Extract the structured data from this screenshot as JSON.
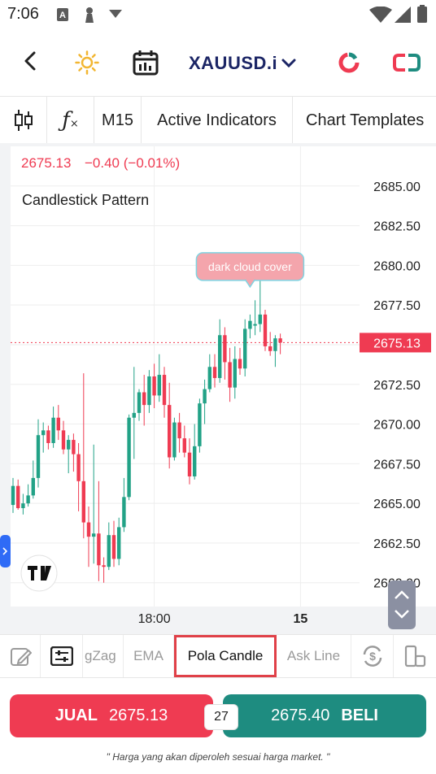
{
  "status": {
    "time": "7:06"
  },
  "header": {
    "symbol": "XAUUSD.i"
  },
  "toolbar": {
    "items": [
      {
        "label": "M15"
      },
      {
        "label": "Active Indicators"
      },
      {
        "label": "Chart Templates"
      }
    ]
  },
  "chart": {
    "price_label": "2675.13",
    "change_label": "−0.40 (−0.01%)",
    "title": "Candlestick Pattern",
    "annotation": "dark cloud cover",
    "current_price_tag": "2675.13",
    "logo": "TV"
  },
  "chart_data": {
    "type": "candlestick",
    "title": "Candlestick Pattern",
    "symbol": "XAUUSD.i",
    "timeframe": "M15",
    "ylim": [
      2658.5,
      2687.5
    ],
    "y_ticks": [
      "2685.00",
      "2682.50",
      "2680.00",
      "2677.50",
      "2675.00",
      "2672.50",
      "2670.00",
      "2667.50",
      "2665.00",
      "2662.50",
      "2660.00"
    ],
    "x_ticks": [
      "18:00",
      "15"
    ],
    "last_price": 2675.13,
    "annotation": {
      "text": "dark cloud cover",
      "candle_index": 47
    },
    "up_color": "#22a287",
    "down_color": "#ef3b52",
    "candles": [
      {
        "o": 2664.9,
        "h": 2666.6,
        "l": 2664.4,
        "c": 2666.1
      },
      {
        "o": 2666.1,
        "h": 2666.5,
        "l": 2664.6,
        "c": 2664.7
      },
      {
        "o": 2664.7,
        "h": 2665.6,
        "l": 2664.3,
        "c": 2665.0
      },
      {
        "o": 2665.0,
        "h": 2666.2,
        "l": 2664.8,
        "c": 2665.5
      },
      {
        "o": 2665.5,
        "h": 2667.7,
        "l": 2665.3,
        "c": 2666.6
      },
      {
        "o": 2666.6,
        "h": 2670.3,
        "l": 2666.0,
        "c": 2669.3
      },
      {
        "o": 2669.3,
        "h": 2670.1,
        "l": 2668.2,
        "c": 2669.6
      },
      {
        "o": 2669.6,
        "h": 2669.9,
        "l": 2668.4,
        "c": 2668.8
      },
      {
        "o": 2668.8,
        "h": 2671.1,
        "l": 2668.5,
        "c": 2670.4
      },
      {
        "o": 2670.4,
        "h": 2671.2,
        "l": 2669.0,
        "c": 2669.6
      },
      {
        "o": 2669.6,
        "h": 2670.2,
        "l": 2668.1,
        "c": 2668.4
      },
      {
        "o": 2668.4,
        "h": 2669.3,
        "l": 2666.9,
        "c": 2669.0
      },
      {
        "o": 2669.0,
        "h": 2669.4,
        "l": 2667.0,
        "c": 2668.1
      },
      {
        "o": 2668.1,
        "h": 2668.8,
        "l": 2664.5,
        "c": 2666.4
      },
      {
        "o": 2666.4,
        "h": 2673.2,
        "l": 2662.8,
        "c": 2663.8
      },
      {
        "o": 2663.8,
        "h": 2664.8,
        "l": 2661.0,
        "c": 2662.9
      },
      {
        "o": 2662.9,
        "h": 2668.7,
        "l": 2661.2,
        "c": 2663.1
      },
      {
        "o": 2663.1,
        "h": 2666.4,
        "l": 2660.1,
        "c": 2661.1
      },
      {
        "o": 2661.1,
        "h": 2661.6,
        "l": 2660.0,
        "c": 2661.0
      },
      {
        "o": 2661.0,
        "h": 2663.8,
        "l": 2660.8,
        "c": 2663.0
      },
      {
        "o": 2663.0,
        "h": 2663.9,
        "l": 2661.0,
        "c": 2661.5
      },
      {
        "o": 2661.5,
        "h": 2664.1,
        "l": 2661.1,
        "c": 2663.5
      },
      {
        "o": 2663.5,
        "h": 2666.6,
        "l": 2663.2,
        "c": 2665.4
      },
      {
        "o": 2665.4,
        "h": 2670.6,
        "l": 2665.2,
        "c": 2670.4
      },
      {
        "o": 2670.4,
        "h": 2673.6,
        "l": 2667.8,
        "c": 2670.7
      },
      {
        "o": 2670.7,
        "h": 2672.2,
        "l": 2670.2,
        "c": 2672.0
      },
      {
        "o": 2672.0,
        "h": 2673.1,
        "l": 2669.9,
        "c": 2671.2
      },
      {
        "o": 2671.2,
        "h": 2673.4,
        "l": 2670.7,
        "c": 2673.0
      },
      {
        "o": 2673.0,
        "h": 2673.8,
        "l": 2671.0,
        "c": 2671.8
      },
      {
        "o": 2671.8,
        "h": 2674.4,
        "l": 2671.4,
        "c": 2673.1
      },
      {
        "o": 2673.1,
        "h": 2673.6,
        "l": 2670.4,
        "c": 2671.2
      },
      {
        "o": 2671.2,
        "h": 2672.6,
        "l": 2667.2,
        "c": 2667.9
      },
      {
        "o": 2667.9,
        "h": 2670.4,
        "l": 2667.7,
        "c": 2670.1
      },
      {
        "o": 2670.1,
        "h": 2670.7,
        "l": 2668.2,
        "c": 2669.1
      },
      {
        "o": 2669.1,
        "h": 2669.9,
        "l": 2667.9,
        "c": 2668.2
      },
      {
        "o": 2668.2,
        "h": 2669.1,
        "l": 2666.2,
        "c": 2666.7
      },
      {
        "o": 2666.7,
        "h": 2670.0,
        "l": 2666.5,
        "c": 2668.6
      },
      {
        "o": 2668.6,
        "h": 2671.6,
        "l": 2668.2,
        "c": 2671.3
      },
      {
        "o": 2671.3,
        "h": 2672.8,
        "l": 2670.0,
        "c": 2672.2
      },
      {
        "o": 2672.2,
        "h": 2674.4,
        "l": 2672.0,
        "c": 2673.6
      },
      {
        "o": 2673.6,
        "h": 2674.4,
        "l": 2672.3,
        "c": 2672.9
      },
      {
        "o": 2672.9,
        "h": 2676.6,
        "l": 2672.6,
        "c": 2675.6
      },
      {
        "o": 2675.6,
        "h": 2676.1,
        "l": 2672.8,
        "c": 2673.9
      },
      {
        "o": 2673.9,
        "h": 2674.8,
        "l": 2671.4,
        "c": 2672.3
      },
      {
        "o": 2672.3,
        "h": 2674.9,
        "l": 2671.6,
        "c": 2674.1
      },
      {
        "o": 2674.1,
        "h": 2674.8,
        "l": 2673.1,
        "c": 2673.5
      },
      {
        "o": 2673.5,
        "h": 2676.6,
        "l": 2673.0,
        "c": 2676.0
      },
      {
        "o": 2676.0,
        "h": 2676.9,
        "l": 2675.4,
        "c": 2676.5
      },
      {
        "o": 2676.2,
        "h": 2677.8,
        "l": 2675.6,
        "c": 2676.3
      },
      {
        "o": 2676.3,
        "h": 2679.7,
        "l": 2675.8,
        "c": 2676.9
      },
      {
        "o": 2676.9,
        "h": 2677.2,
        "l": 2674.6,
        "c": 2674.9
      },
      {
        "o": 2674.9,
        "h": 2675.8,
        "l": 2674.3,
        "c": 2674.6
      },
      {
        "o": 2674.6,
        "h": 2675.6,
        "l": 2673.6,
        "c": 2675.4
      },
      {
        "o": 2675.4,
        "h": 2675.7,
        "l": 2674.4,
        "c": 2675.13
      }
    ]
  },
  "tabs": [
    {
      "label": "gZag"
    },
    {
      "label": "EMA"
    },
    {
      "label": "Pola Candle"
    },
    {
      "label": "Ask Line"
    }
  ],
  "trade": {
    "sell_label": "JUAL",
    "sell_price": "2675.13",
    "spread": "27",
    "buy_price": "2675.40",
    "buy_label": "BELI"
  },
  "note": "\" Harga yang akan diperoleh sesuai harga market. \""
}
